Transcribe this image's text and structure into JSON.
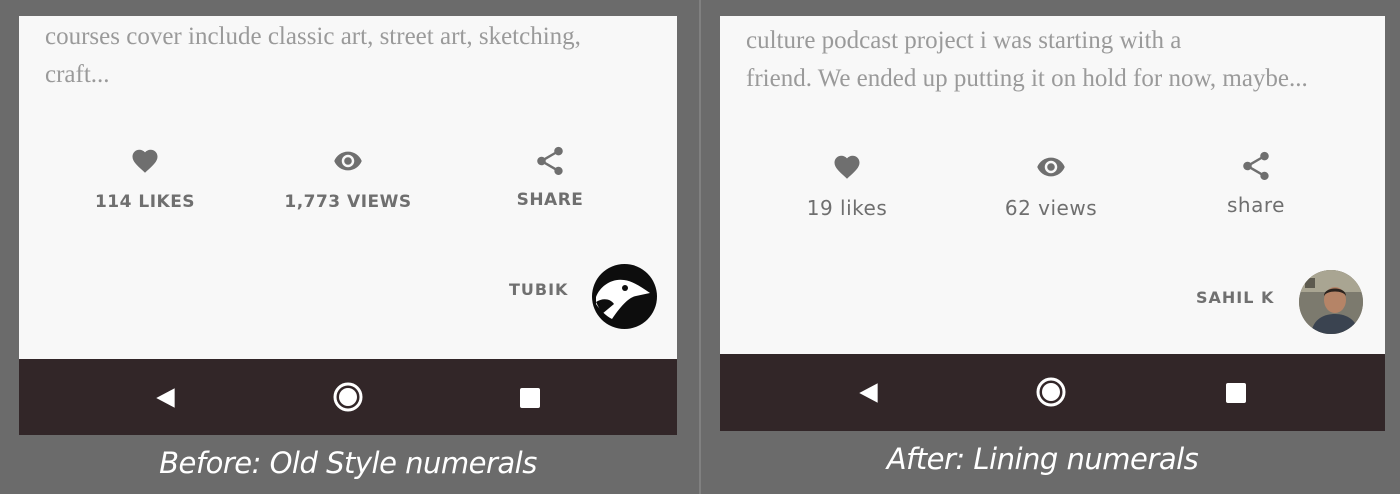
{
  "before": {
    "excerpt_line1": "courses cover include classic art, street art, sketching,",
    "excerpt_line2": "craft...",
    "likes_label": "114 LIKES",
    "views_label": "1,773 VIEWS",
    "share_label": "SHARE",
    "author_name": "TUBIK",
    "caption": "Before: Old Style numerals"
  },
  "after": {
    "excerpt_line1": "culture podcast project i was starting with a",
    "excerpt_line2": "friend. We ended up putting it on hold for now, maybe...",
    "likes_label": "19 likes",
    "views_label": "62 views",
    "share_label": "share",
    "author_name": "SAHIL K",
    "caption": "After: Lining numerals"
  },
  "icons": {
    "likes": "heart-icon",
    "views": "eye-icon",
    "share": "share-icon",
    "nav_back": "back-triangle-icon",
    "nav_home": "home-circle-icon",
    "nav_recents": "recents-square-icon"
  },
  "colors": {
    "background": "#6b6b6b",
    "card": "#f8f8f8",
    "navbar": "#322628",
    "icon": "#6f6f6f",
    "excerpt_text": "#9a9a9a"
  }
}
